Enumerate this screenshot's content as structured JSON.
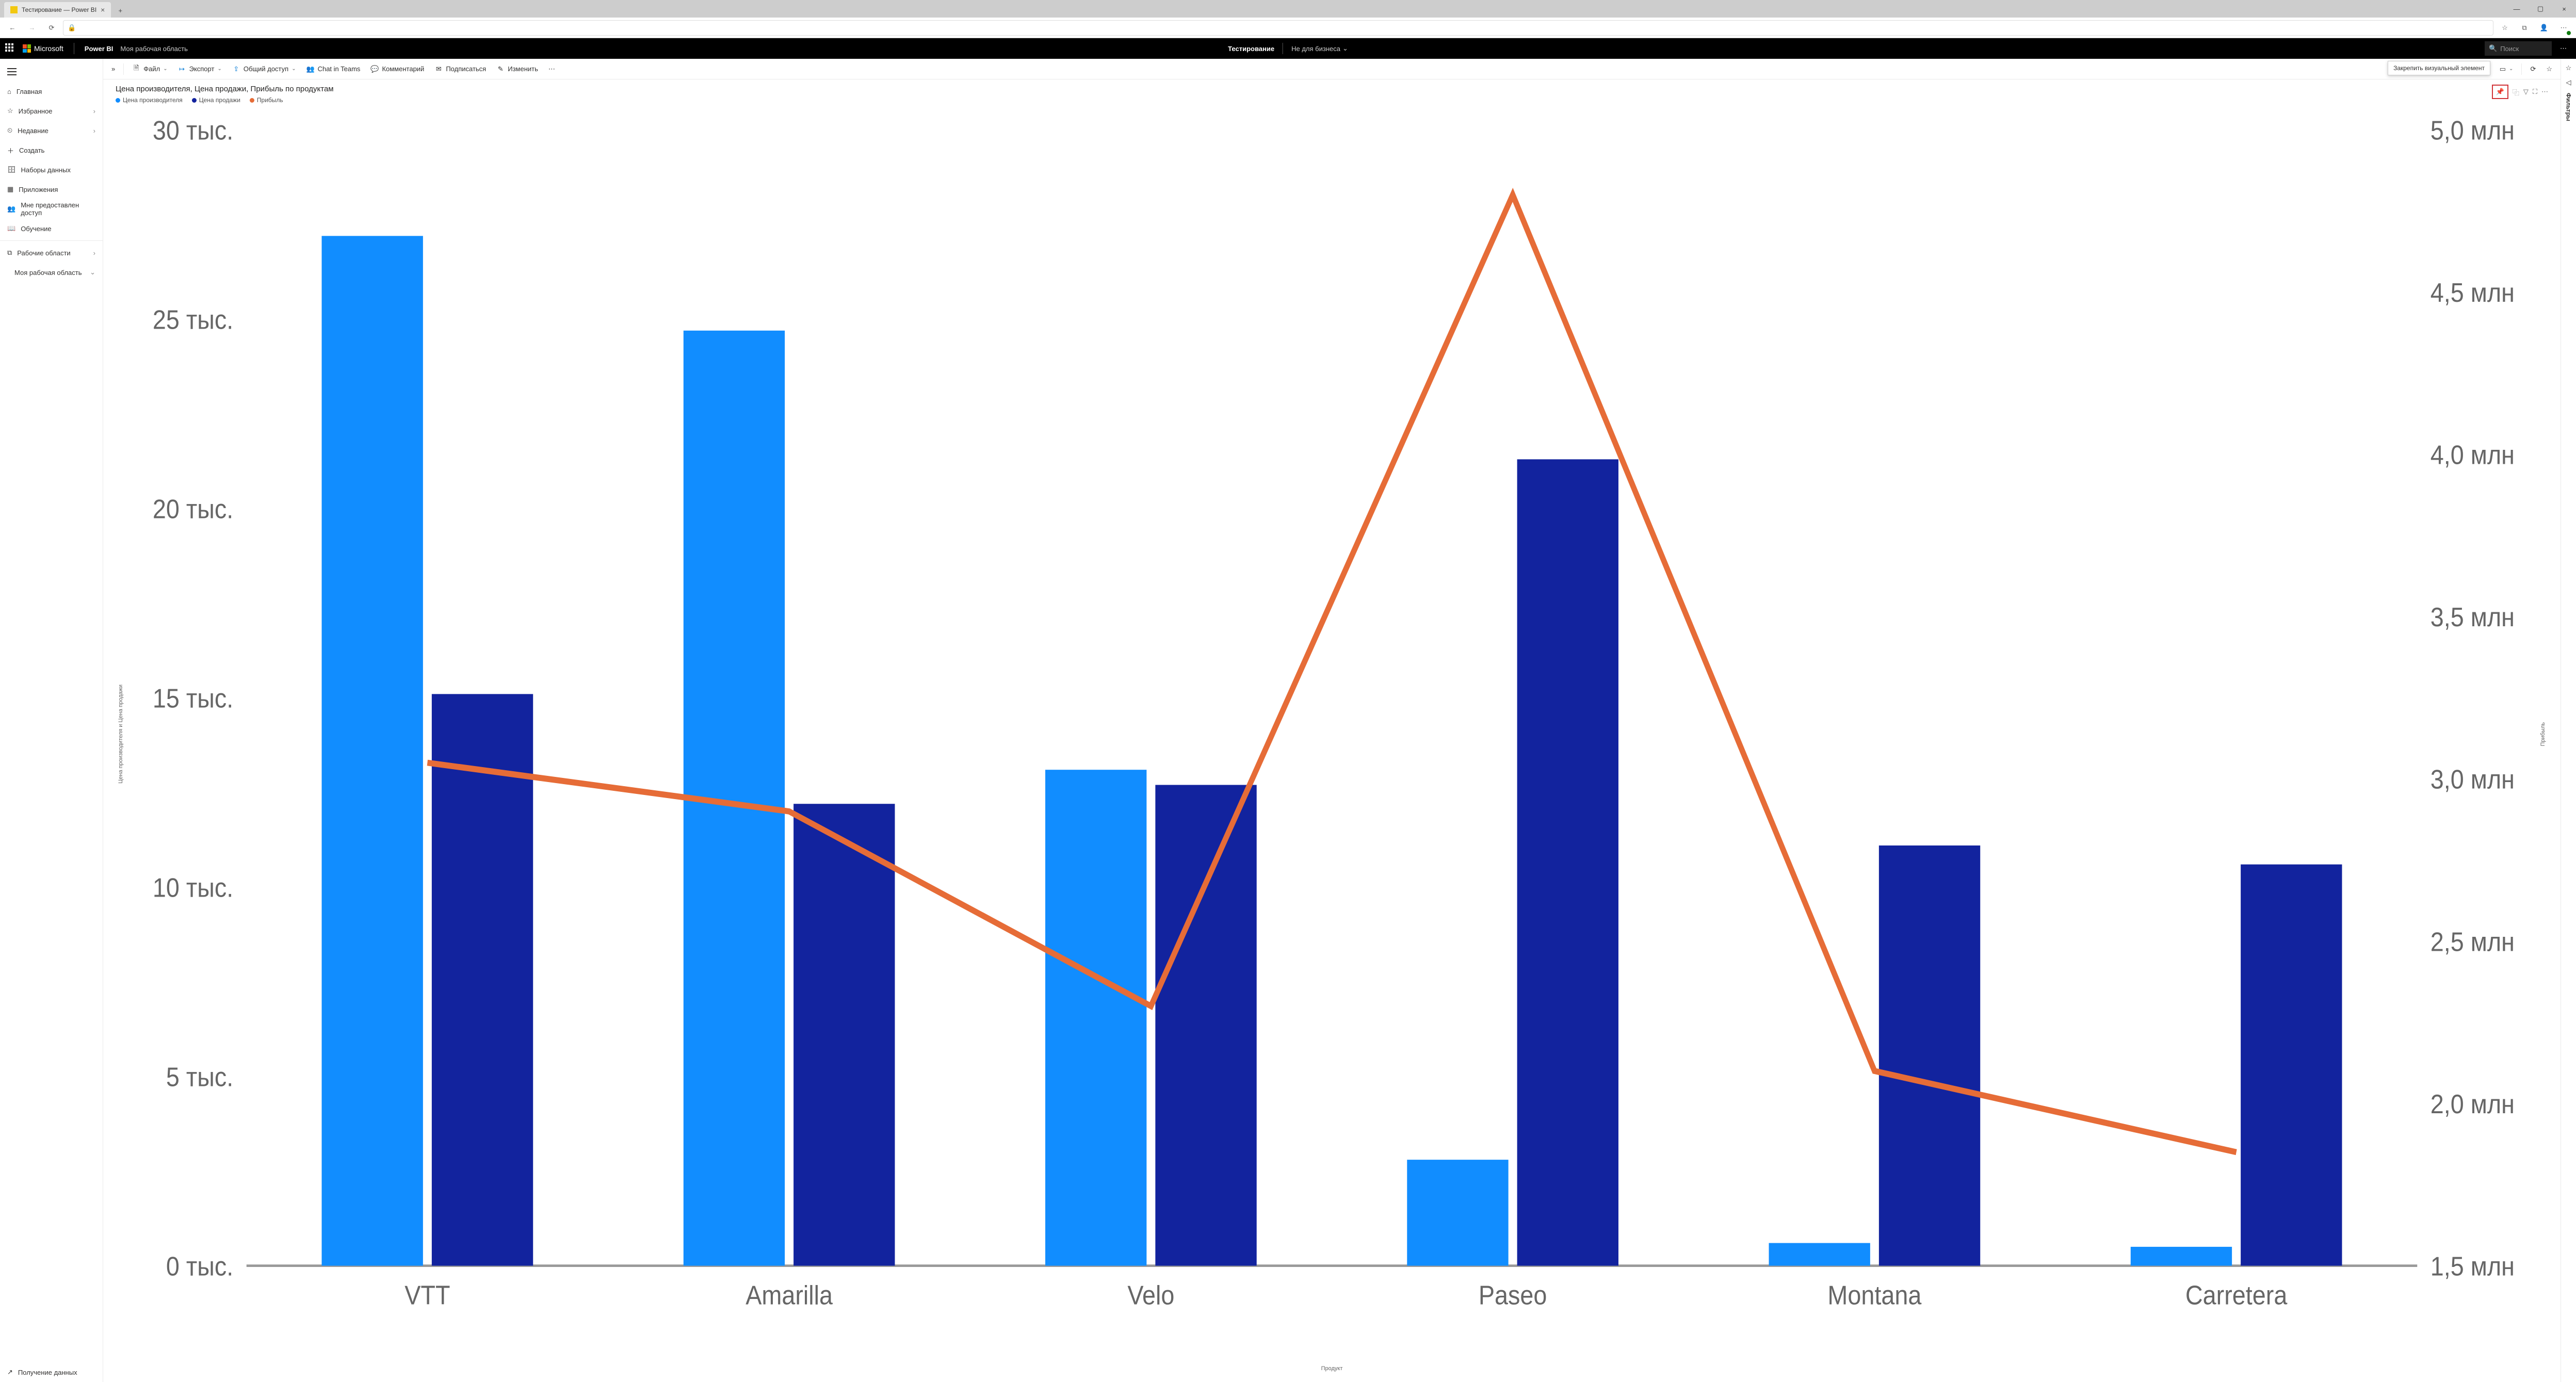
{
  "browser": {
    "tab_title": "Тестирование — Power BI",
    "close_glyph": "×",
    "newtab_glyph": "+",
    "win": {
      "min": "—",
      "max": "▢",
      "close": "×"
    },
    "addr_lock": "🔒"
  },
  "pbi_header": {
    "microsoft": "Microsoft",
    "product": "Power BI",
    "breadcrumb": "Моя рабочая область",
    "doc_name": "Тестирование",
    "badge": "Не для бизнеса",
    "search_placeholder": "Поиск",
    "more": "⋯"
  },
  "left_nav": {
    "items": [
      {
        "icon": "⌂",
        "label": "Главная"
      },
      {
        "icon": "☆",
        "label": "Избранное",
        "chev": "›"
      },
      {
        "icon": "⏲",
        "label": "Недавние",
        "chev": "›"
      },
      {
        "icon": "＋",
        "label": "Создать"
      },
      {
        "icon": "🗄",
        "label": "Наборы данных"
      },
      {
        "icon": "▦",
        "label": "Приложения"
      },
      {
        "icon": "👥",
        "label": "Мне предоставлен доступ"
      },
      {
        "icon": "📖",
        "label": "Обучение"
      }
    ],
    "workspaces_label": "Рабочие области",
    "workspaces_icon": "⧉",
    "my_workspace": "Моя рабочая область",
    "get_data_icon": "↗",
    "get_data": "Получение данных"
  },
  "ribbon": {
    "expand": "»",
    "file": "Файл",
    "export": "Экспорт",
    "share": "Общий доступ",
    "chat": "Chat in Teams",
    "comment": "Комментарий",
    "subscribe": "Подписаться",
    "edit": "Изменить",
    "more": "⋯",
    "bookmark": "🔖",
    "view": "▭",
    "refresh": "⟳",
    "favorite": "☆",
    "tooltip": "Закрепить визуальный элемент"
  },
  "visual_tools": {
    "pin": "📌",
    "copy": "⿻",
    "filter": "▽",
    "focus": "⛶",
    "more": "⋯"
  },
  "right_pane": {
    "star": "☆",
    "chev": "◁",
    "filters": "Фильтры"
  },
  "chart_data": {
    "type": "bar+line",
    "title": "Цена производителя, Цена продажи, Прибыль по продуктам",
    "xlabel": "Продукт",
    "ylabel_left": "Цена производителя и Цена продажи",
    "ylabel_right": "Прибыль",
    "left_axis": {
      "min": 0,
      "max": 30,
      "unit": "тыс.",
      "ticks": [
        0,
        5,
        10,
        15,
        20,
        25,
        30
      ]
    },
    "right_axis": {
      "min": 1.5,
      "max": 5.0,
      "unit": "млн",
      "ticks": [
        1.5,
        2.0,
        2.5,
        3.0,
        3.5,
        4.0,
        4.5,
        5.0
      ]
    },
    "categories": [
      "VTT",
      "Amarilla",
      "Velo",
      "Paseo",
      "Montana",
      "Carretera"
    ],
    "series": [
      {
        "name": "Цена производителя",
        "color": "#118dff",
        "type": "bar",
        "axis": "left",
        "values": [
          27.2,
          24.7,
          13.1,
          2.8,
          0.6,
          0.5
        ]
      },
      {
        "name": "Цена продажи",
        "color": "#12239e",
        "type": "bar",
        "axis": "left",
        "values": [
          15.1,
          12.2,
          12.7,
          21.3,
          11.1,
          10.6
        ]
      },
      {
        "name": "Прибыль",
        "color": "#e66c37",
        "type": "line",
        "axis": "right",
        "values": [
          3.05,
          2.9,
          2.3,
          4.8,
          2.1,
          1.85
        ]
      }
    ],
    "legend": [
      "Цена производителя",
      "Цена продажи",
      "Прибыль"
    ]
  }
}
